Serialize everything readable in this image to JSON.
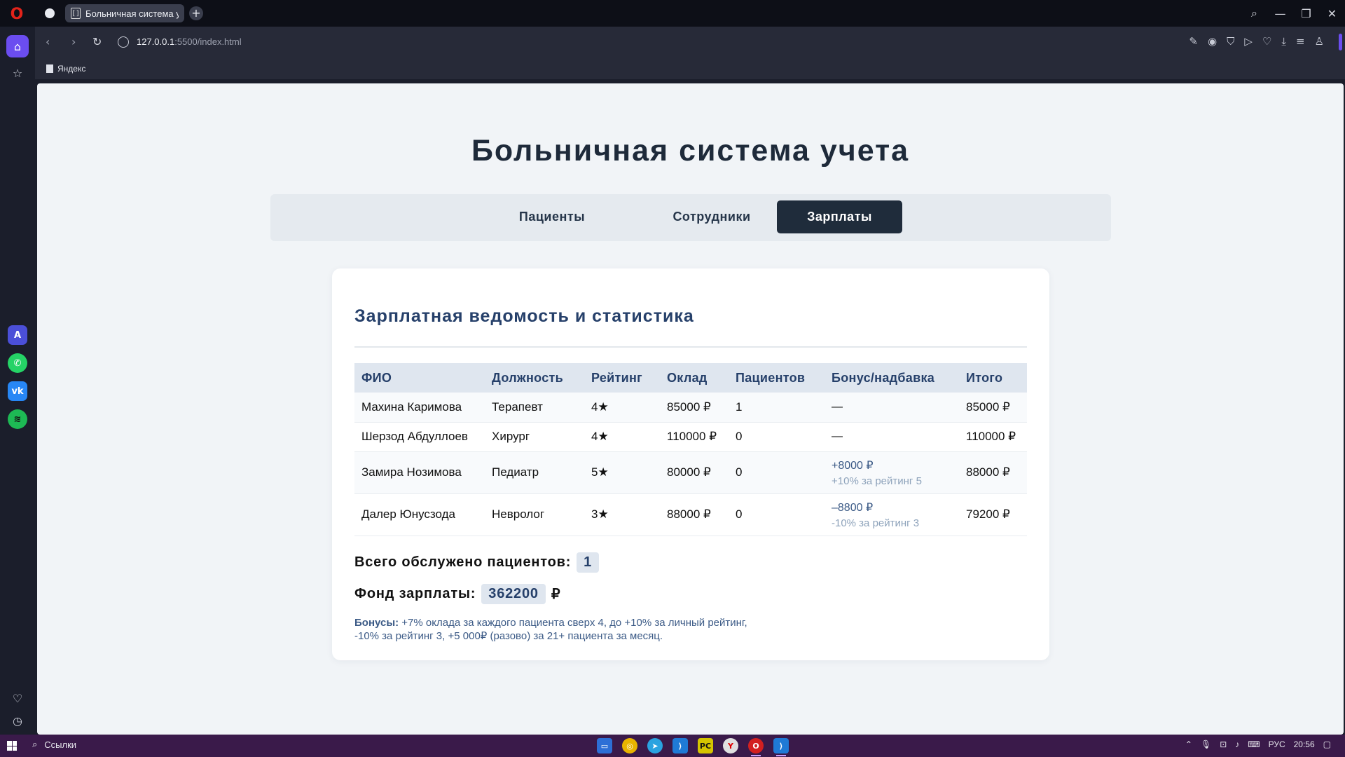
{
  "browser": {
    "tab_title": "Больничная система учет",
    "url_host": "127.0.0.1",
    "url_path": ":5500/index.html",
    "bookmark": "Яндекс"
  },
  "app": {
    "title": "Больничная система учета",
    "tabs": [
      {
        "label": "Пациенты",
        "active": false
      },
      {
        "label": "Сотрудники",
        "active": false
      },
      {
        "label": "Зарплаты",
        "active": true
      }
    ]
  },
  "payroll": {
    "title": "Зарплатная ведомость и статистика",
    "columns": [
      "ФИО",
      "Должность",
      "Рейтинг",
      "Оклад",
      "Пациентов",
      "Бонус/надбавка",
      "Итого"
    ],
    "rows": [
      {
        "name": "Махина Каримова",
        "position": "Терапевт",
        "rating": "4★",
        "salary": "85000 ₽",
        "patients": "1",
        "bonus": "—",
        "bonus_note": "",
        "total": "85000 ₽"
      },
      {
        "name": "Шерзод Абдуллоев",
        "position": "Хирург",
        "rating": "4★",
        "salary": "110000 ₽",
        "patients": "0",
        "bonus": "—",
        "bonus_note": "",
        "total": "110000 ₽"
      },
      {
        "name": "Замира Нозимова",
        "position": "Педиатр",
        "rating": "5★",
        "salary": "80000 ₽",
        "patients": "0",
        "bonus": "+8000 ₽",
        "bonus_note": "+10% за рейтинг 5",
        "total": "88000 ₽"
      },
      {
        "name": "Далер Юнусзода",
        "position": "Невролог",
        "rating": "3★",
        "salary": "88000 ₽",
        "patients": "0",
        "bonus": "–8800 ₽",
        "bonus_note": "-10% за рейтинг 3",
        "total": "79200 ₽"
      }
    ],
    "total_patients_label": "Всего обслужено пациентов:",
    "total_patients": "1",
    "fund_label": "Фонд зарплаты:",
    "fund_value": "362200",
    "fund_currency": "₽",
    "bonus_label": "Бонусы:",
    "bonus_text_1": " +7% оклада за каждого пациента сверх 4, до +10% за личный рейтинг,",
    "bonus_text_2": "-10% за рейтинг 3, +5 000₽ (разово) за 21+ пациента за месяц."
  },
  "taskbar": {
    "search_label": "Ссылки",
    "lang": "РУС",
    "time": "20:56"
  }
}
